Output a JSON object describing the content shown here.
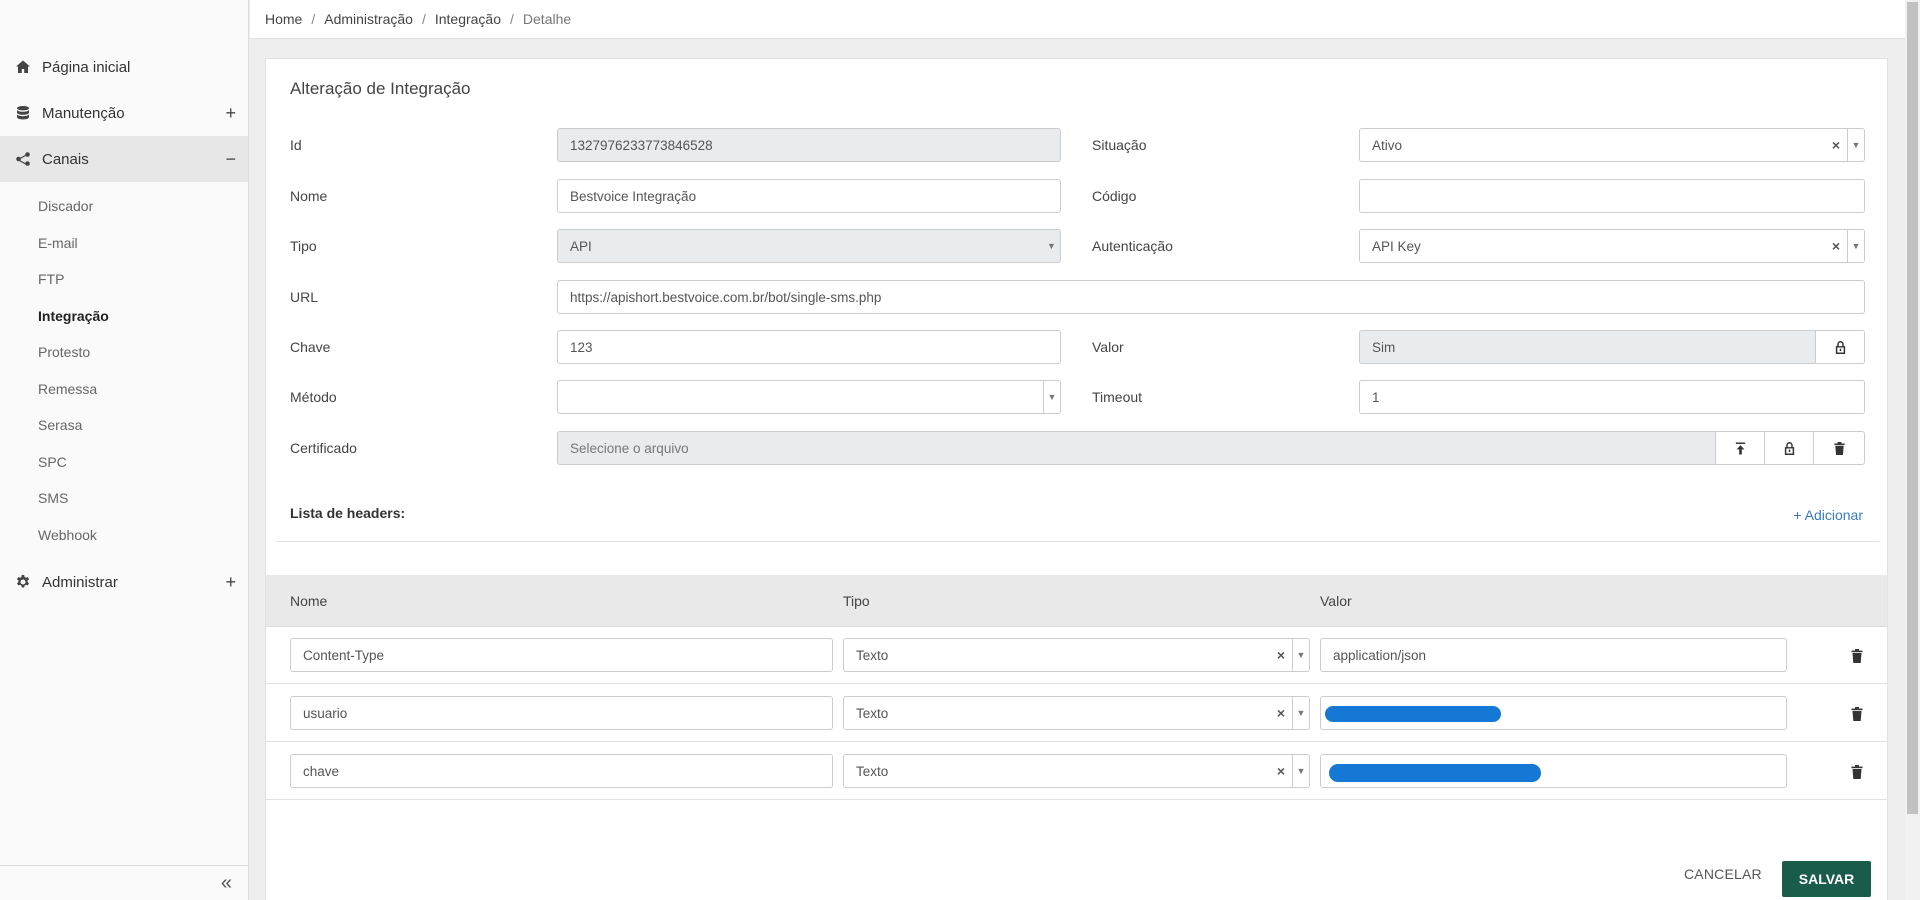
{
  "breadcrumb": [
    "Home",
    "Administração",
    "Integração",
    "Detalhe"
  ],
  "sidebar": {
    "items": [
      {
        "label": "Página inicial",
        "icon": "home-icon"
      },
      {
        "label": "Manutenção",
        "icon": "database-icon",
        "toggle": "+"
      },
      {
        "label": "Canais",
        "icon": "share-icon",
        "toggle": "−"
      }
    ],
    "sub": [
      "Discador",
      "E-mail",
      "FTP",
      "Integração",
      "Protesto",
      "Remessa",
      "Serasa",
      "SPC",
      "SMS",
      "Webhook"
    ],
    "admin": {
      "label": "Administrar",
      "icon": "gear-icon",
      "toggle": "+"
    },
    "collapse": "«"
  },
  "form": {
    "title": "Alteração de Integração",
    "id_label": "Id",
    "id_value": "1327976233773846528",
    "situacao_label": "Situação",
    "situacao_value": "Ativo",
    "nome_label": "Nome",
    "nome_value": "Bestvoice Integração",
    "codigo_label": "Código",
    "codigo_value": "",
    "tipo_label": "Tipo",
    "tipo_value": "API",
    "autenticacao_label": "Autenticação",
    "autenticacao_value": "API Key",
    "url_label": "URL",
    "url_value": "https://apishort.bestvoice.com.br/bot/single-sms.php",
    "chave_label": "Chave",
    "chave_value": "123",
    "valor_label": "Valor",
    "valor_value": "Sim",
    "metodo_label": "Método",
    "metodo_value": "",
    "timeout_label": "Timeout",
    "timeout_value": "1",
    "certificado_label": "Certificado",
    "certificado_placeholder": "Selecione o arquivo"
  },
  "headers": {
    "title": "Lista de headers:",
    "add": "+ Adicionar",
    "col_nome": "Nome",
    "col_tipo": "Tipo",
    "col_valor": "Valor",
    "rows": [
      {
        "nome": "Content-Type",
        "tipo": "Texto",
        "valor": "application/json"
      },
      {
        "nome": "usuario",
        "tipo": "Texto",
        "valor": ""
      },
      {
        "nome": "chave",
        "tipo": "Texto",
        "valor": ""
      }
    ]
  },
  "actions": {
    "cancel": "CANCELAR",
    "save": "SALVAR"
  }
}
